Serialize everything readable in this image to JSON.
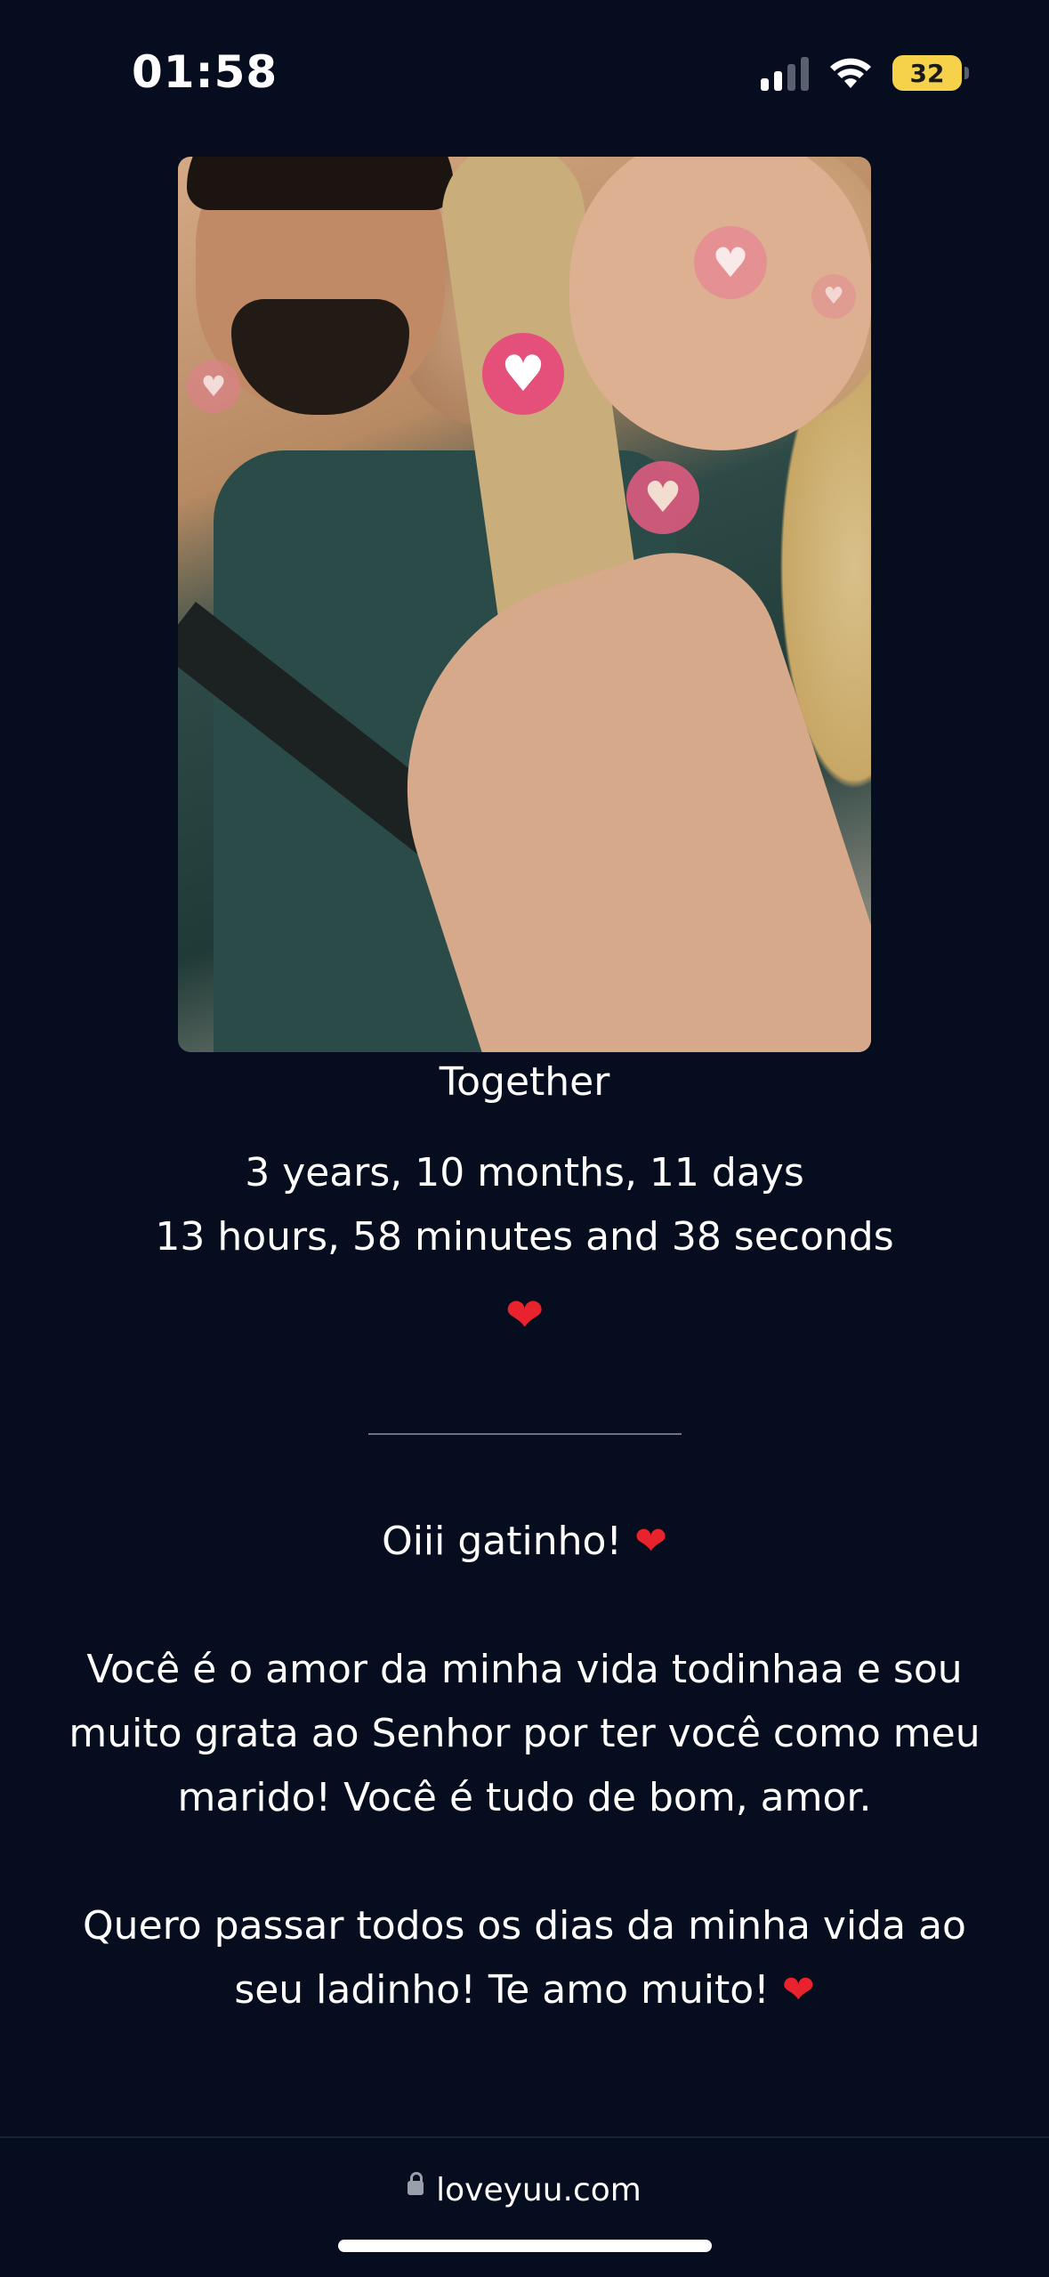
{
  "status": {
    "time": "01:58",
    "battery": "32"
  },
  "photo": {
    "heart_icon": "♥"
  },
  "together_label": "Together",
  "counter": {
    "line1": "3 years, 10 months, 11 days",
    "line2": "13 hours, 58 minutes and 38 seconds",
    "heart": "❤"
  },
  "message": {
    "greeting": "Oiii gatinho!",
    "paragraph1": "Você é o amor da minha vida todinhaa e sou muito grata ao Senhor por ter você como meu marido! Você é tudo de bom, amor.",
    "paragraph2": "Quero passar todos os dias da minha vida ao seu ladinho! Te amo muito!",
    "heart": "❤"
  },
  "browser": {
    "url": "loveyuu.com"
  },
  "colors": {
    "background": "#050d1f",
    "heart_pink": "#e4507a",
    "heart_red": "#e8232d",
    "battery_yellow": "#f5d24a"
  }
}
